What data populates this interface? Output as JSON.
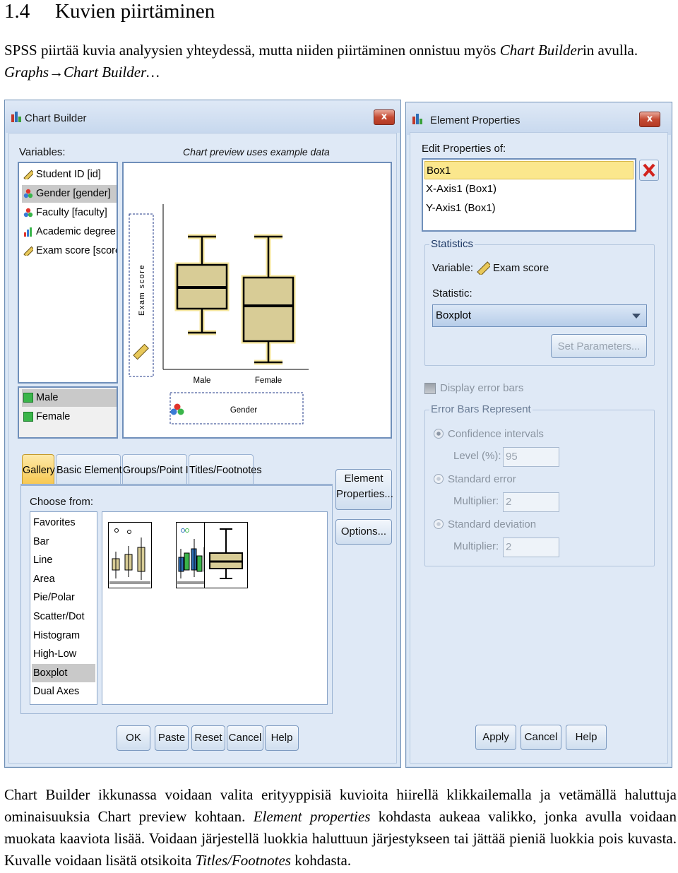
{
  "section": {
    "number": "1.4",
    "title": "Kuvien piirtäminen"
  },
  "intro": {
    "part1": "SPSS piirtää kuvia analyysien yhteydessä, mutta niiden piirtäminen onnistuu myös ",
    "italic1": "Chart Builder",
    "part2": "in avulla. ",
    "italic2": "Graphs→Chart Builder…"
  },
  "chart_builder": {
    "title": "Chart Builder",
    "close_label": "x",
    "variables_label": "Variables:",
    "preview_label": "Chart preview uses example data",
    "variables": [
      {
        "label": "Student ID [id]",
        "icon": "ruler-icon"
      },
      {
        "label": "Gender [gender]",
        "icon": "nominal-icon",
        "selected": true
      },
      {
        "label": "Faculty [faculty]",
        "icon": "nominal-icon"
      },
      {
        "label": "Academic degree [d...",
        "icon": "ordinal-icon"
      },
      {
        "label": "Exam score [score]",
        "icon": "ruler-icon"
      }
    ],
    "categories": [
      "Male",
      "Female"
    ],
    "preview": {
      "y_axis_label": "Exam score",
      "x_axis_label": "Gender",
      "box_categories": [
        "Male",
        "Female"
      ]
    },
    "tabs": [
      "Gallery",
      "Basic Elements",
      "Groups/Point ID",
      "Titles/Footnotes"
    ],
    "choose_from_label": "Choose from:",
    "chart_types": [
      "Favorites",
      "Bar",
      "Line",
      "Area",
      "Pie/Polar",
      "Scatter/Dot",
      "Histogram",
      "High-Low",
      "Boxplot",
      "Dual Axes"
    ],
    "selected_chart_type": "Boxplot",
    "element_properties_button": [
      "Element",
      "Properties..."
    ],
    "options_button": "Options...",
    "buttons": [
      "OK",
      "Paste",
      "Reset",
      "Cancel",
      "Help"
    ]
  },
  "element_properties": {
    "title": "Element Properties",
    "close_label": "x",
    "edit_properties_label": "Edit Properties of:",
    "items": [
      "Box1",
      "X-Axis1 (Box1)",
      "Y-Axis1 (Box1)"
    ],
    "selected_item": "Box1",
    "statistics_group": "Statistics",
    "variable_label": "Variable:",
    "variable_value": "Exam score",
    "statistic_label": "Statistic:",
    "statistic_value": "Boxplot",
    "set_parameters_button": "Set Parameters...",
    "display_error_bars": "Display error bars",
    "error_bars_group": "Error Bars Represent",
    "confidence_intervals": "Confidence intervals",
    "level_label": "Level (%):",
    "level_value": "95",
    "standard_error": "Standard error",
    "multiplier_label_1": "Multiplier:",
    "multiplier_value_1": "2",
    "standard_deviation": "Standard deviation",
    "multiplier_label_2": "Multiplier:",
    "multiplier_value_2": "2",
    "buttons": [
      "Apply",
      "Cancel",
      "Help"
    ]
  },
  "outro": {
    "part1": "Chart Builder ikkunassa voidaan valita erityyppisiä kuvioita hiirellä klikkailemalla ja vetämällä haluttuja ominaisuuksia Chart preview kohtaan. ",
    "italic1": "Element properties",
    "part2": " kohdasta aukeaa valikko, jonka avulla voidaan muokata kaaviota lisää. Voidaan järjestellä luokkia haluttuun järjestykseen tai jättää pieniä luokkia pois kuvasta. Kuvalle voidaan lisätä otsikoita ",
    "italic2": "Titles/Footnotes",
    "part3": " kohdasta."
  },
  "colors": {
    "window_bg": "#dfe9f6",
    "selection_yellow": "#fbe78d",
    "box_fill": "#d8cc96",
    "close_red": "#c54a33",
    "active_tab": "#f7c74f"
  }
}
